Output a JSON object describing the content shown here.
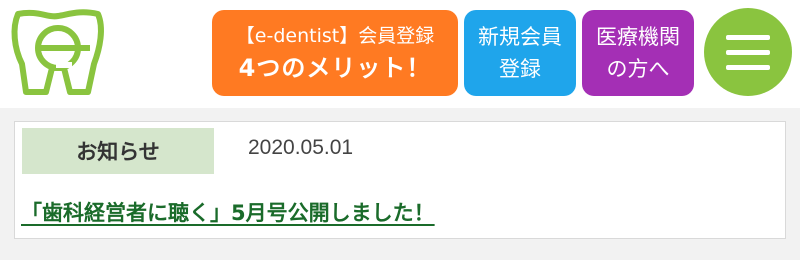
{
  "header": {
    "logo_icon": "tooth-e-logo-icon",
    "merit_button": {
      "line1": "【e-dentist】会員登録",
      "line2": "4つのメリット！",
      "color": "#ff7a22"
    },
    "signup_button": {
      "line1": "新規会員",
      "line2": "登録",
      "color": "#1fa5eb"
    },
    "medical_button": {
      "line1": "医療機関",
      "line2": "の方へ",
      "color": "#a42fb5"
    },
    "menu_button": {
      "icon": "hamburger-menu-icon",
      "color": "#8ac43f"
    }
  },
  "news": {
    "label": "お知らせ",
    "date": "2020.05.01",
    "headline": "「歯科経営者に聴く」5月号公開しました！",
    "link_color": "#1a6b2a"
  }
}
